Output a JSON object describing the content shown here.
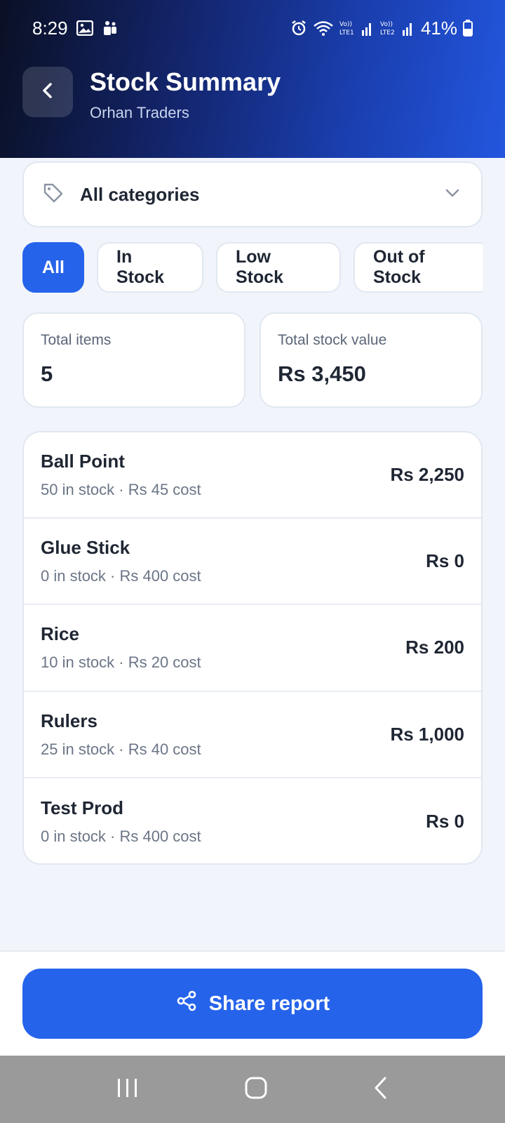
{
  "status_bar": {
    "time": "8:29",
    "battery": "41%"
  },
  "header": {
    "title": "Stock Summary",
    "subtitle": "Orhan Traders"
  },
  "category_select": {
    "value": "All categories"
  },
  "filters": [
    {
      "label": "All",
      "active": true
    },
    {
      "label": "In Stock",
      "active": false
    },
    {
      "label": "Low Stock",
      "active": false
    },
    {
      "label": "Out of Stock",
      "active": false
    }
  ],
  "stats": {
    "total_items": {
      "label": "Total items",
      "value": "5"
    },
    "total_value": {
      "label": "Total stock value",
      "value": "Rs 3,450"
    }
  },
  "products": [
    {
      "name": "Ball Point",
      "meta": "50 in stock · Rs 45 cost",
      "value": "Rs 2,250"
    },
    {
      "name": "Glue Stick",
      "meta": "0 in stock · Rs 400 cost",
      "value": "Rs 0"
    },
    {
      "name": "Rice",
      "meta": "10 in stock · Rs 20 cost",
      "value": "Rs 200"
    },
    {
      "name": "Rulers",
      "meta": "25 in stock · Rs 40 cost",
      "value": "Rs 1,000"
    },
    {
      "name": "Test Prod",
      "meta": "0 in stock · Rs 400 cost",
      "value": "Rs 0"
    }
  ],
  "actions": {
    "share_label": "Share report"
  },
  "colors": {
    "accent": "#2563eb",
    "header_dark": "#0a1024",
    "background": "#f1f5fb"
  }
}
